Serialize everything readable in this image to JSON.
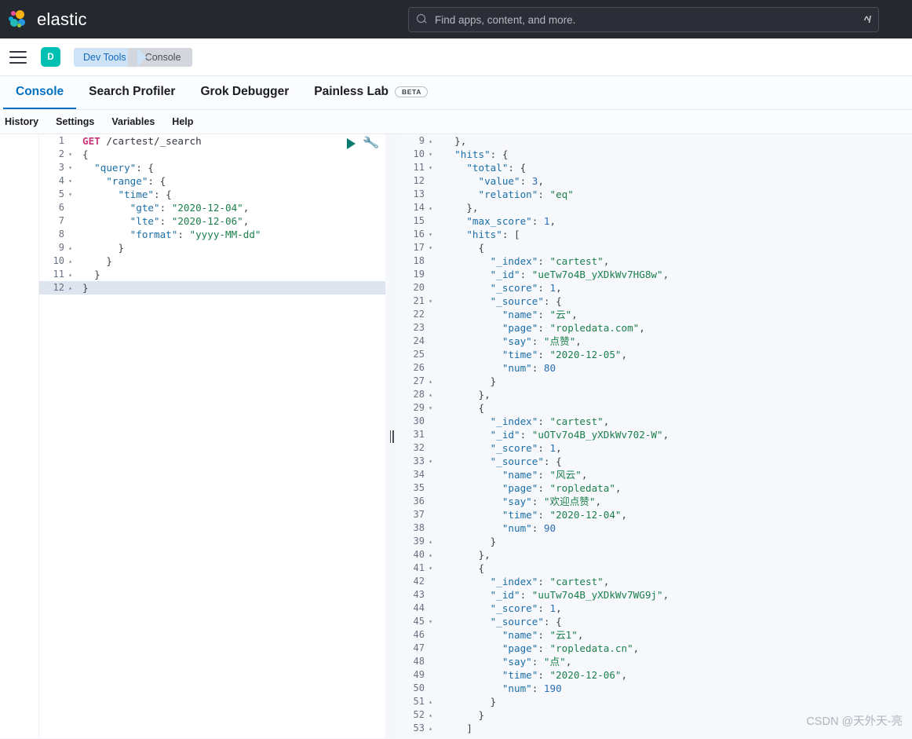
{
  "header": {
    "brand": "elastic",
    "search": {
      "placeholder": "Find apps, content, and more.",
      "value": "",
      "shortcut": "^/"
    }
  },
  "nav": {
    "avatar_initial": "D",
    "breadcrumb": [
      "Dev Tools",
      "Console"
    ]
  },
  "tabs": [
    {
      "label": "Console",
      "active": true,
      "badge": ""
    },
    {
      "label": "Search Profiler",
      "active": false,
      "badge": ""
    },
    {
      "label": "Grok Debugger",
      "active": false,
      "badge": ""
    },
    {
      "label": "Painless Lab",
      "active": false,
      "badge": "BETA"
    }
  ],
  "subbar": [
    "History",
    "Settings",
    "Variables",
    "Help"
  ],
  "editor": {
    "active_line": 12,
    "lines": [
      {
        "n": 1,
        "fold": "",
        "html": "<span class='t-method'>GET</span> <span class='t-url'>/cartest/_search</span>"
      },
      {
        "n": 2,
        "fold": "▾",
        "html": "<span class='t-brace'>{</span>"
      },
      {
        "n": 3,
        "fold": "▾",
        "html": "  <span class='t-key'>\"query\"</span><span class='t-punc'>: {</span>"
      },
      {
        "n": 4,
        "fold": "▾",
        "html": "    <span class='t-key'>\"range\"</span><span class='t-punc'>: {</span>"
      },
      {
        "n": 5,
        "fold": "▾",
        "html": "      <span class='t-key'>\"time\"</span><span class='t-punc'>: {</span>"
      },
      {
        "n": 6,
        "fold": "",
        "html": "        <span class='t-key'>\"gte\"</span><span class='t-punc'>: </span><span class='t-str'>\"2020-12-04\"</span><span class='t-punc'>,</span>"
      },
      {
        "n": 7,
        "fold": "",
        "html": "        <span class='t-key'>\"lte\"</span><span class='t-punc'>: </span><span class='t-str'>\"2020-12-06\"</span><span class='t-punc'>,</span>"
      },
      {
        "n": 8,
        "fold": "",
        "html": "        <span class='t-key'>\"format\"</span><span class='t-punc'>: </span><span class='t-str'>\"yyyy-MM-dd\"</span>"
      },
      {
        "n": 9,
        "fold": "▴",
        "html": "      <span class='t-punc'>}</span>"
      },
      {
        "n": 10,
        "fold": "▴",
        "html": "    <span class='t-punc'>}</span>"
      },
      {
        "n": 11,
        "fold": "▴",
        "html": "  <span class='t-punc'>}</span>"
      },
      {
        "n": 12,
        "fold": "▴",
        "html": "<span class='t-punc'>}</span>"
      }
    ]
  },
  "response": {
    "lines": [
      {
        "n": 9,
        "fold": "▴",
        "html": "  <span class='t-punc'>},</span>"
      },
      {
        "n": 10,
        "fold": "▾",
        "html": "  <span class='t-key'>\"hits\"</span><span class='t-punc'>: {</span>"
      },
      {
        "n": 11,
        "fold": "▾",
        "html": "    <span class='t-key'>\"total\"</span><span class='t-punc'>: {</span>"
      },
      {
        "n": 12,
        "fold": "",
        "html": "      <span class='t-key'>\"value\"</span><span class='t-punc'>: </span><span class='t-num'>3</span><span class='t-punc'>,</span>"
      },
      {
        "n": 13,
        "fold": "",
        "html": "      <span class='t-key'>\"relation\"</span><span class='t-punc'>: </span><span class='t-str'>\"eq\"</span>"
      },
      {
        "n": 14,
        "fold": "▴",
        "html": "    <span class='t-punc'>},</span>"
      },
      {
        "n": 15,
        "fold": "",
        "html": "    <span class='t-key'>\"max_score\"</span><span class='t-punc'>: </span><span class='t-num'>1</span><span class='t-punc'>,</span>"
      },
      {
        "n": 16,
        "fold": "▾",
        "html": "    <span class='t-key'>\"hits\"</span><span class='t-punc'>: [</span>"
      },
      {
        "n": 17,
        "fold": "▾",
        "html": "      <span class='t-punc'>{</span>"
      },
      {
        "n": 18,
        "fold": "",
        "html": "        <span class='t-key'>\"_index\"</span><span class='t-punc'>: </span><span class='t-str'>\"cartest\"</span><span class='t-punc'>,</span>"
      },
      {
        "n": 19,
        "fold": "",
        "html": "        <span class='t-key'>\"_id\"</span><span class='t-punc'>: </span><span class='t-str'>\"ueTw7o4B_yXDkWv7HG8w\"</span><span class='t-punc'>,</span>"
      },
      {
        "n": 20,
        "fold": "",
        "html": "        <span class='t-key'>\"_score\"</span><span class='t-punc'>: </span><span class='t-num'>1</span><span class='t-punc'>,</span>"
      },
      {
        "n": 21,
        "fold": "▾",
        "html": "        <span class='t-key'>\"_source\"</span><span class='t-punc'>: {</span>"
      },
      {
        "n": 22,
        "fold": "",
        "html": "          <span class='t-key'>\"name\"</span><span class='t-punc'>: </span><span class='t-str'>\"云\"</span><span class='t-punc'>,</span>"
      },
      {
        "n": 23,
        "fold": "",
        "html": "          <span class='t-key'>\"page\"</span><span class='t-punc'>: </span><span class='t-str'>\"ropledata.com\"</span><span class='t-punc'>,</span>"
      },
      {
        "n": 24,
        "fold": "",
        "html": "          <span class='t-key'>\"say\"</span><span class='t-punc'>: </span><span class='t-str'>\"点赞\"</span><span class='t-punc'>,</span>"
      },
      {
        "n": 25,
        "fold": "",
        "html": "          <span class='t-key'>\"time\"</span><span class='t-punc'>: </span><span class='t-str'>\"2020-12-05\"</span><span class='t-punc'>,</span>"
      },
      {
        "n": 26,
        "fold": "",
        "html": "          <span class='t-key'>\"num\"</span><span class='t-punc'>: </span><span class='t-num'>80</span>"
      },
      {
        "n": 27,
        "fold": "▴",
        "html": "        <span class='t-punc'>}</span>"
      },
      {
        "n": 28,
        "fold": "▴",
        "html": "      <span class='t-punc'>},</span>"
      },
      {
        "n": 29,
        "fold": "▾",
        "html": "      <span class='t-punc'>{</span>"
      },
      {
        "n": 30,
        "fold": "",
        "html": "        <span class='t-key'>\"_index\"</span><span class='t-punc'>: </span><span class='t-str'>\"cartest\"</span><span class='t-punc'>,</span>"
      },
      {
        "n": 31,
        "fold": "",
        "html": "        <span class='t-key'>\"_id\"</span><span class='t-punc'>: </span><span class='t-str'>\"uOTv7o4B_yXDkWv702-W\"</span><span class='t-punc'>,</span>"
      },
      {
        "n": 32,
        "fold": "",
        "html": "        <span class='t-key'>\"_score\"</span><span class='t-punc'>: </span><span class='t-num'>1</span><span class='t-punc'>,</span>"
      },
      {
        "n": 33,
        "fold": "▾",
        "html": "        <span class='t-key'>\"_source\"</span><span class='t-punc'>: {</span>"
      },
      {
        "n": 34,
        "fold": "",
        "html": "          <span class='t-key'>\"name\"</span><span class='t-punc'>: </span><span class='t-str'>\"风云\"</span><span class='t-punc'>,</span>"
      },
      {
        "n": 35,
        "fold": "",
        "html": "          <span class='t-key'>\"page\"</span><span class='t-punc'>: </span><span class='t-str'>\"ropledata\"</span><span class='t-punc'>,</span>"
      },
      {
        "n": 36,
        "fold": "",
        "html": "          <span class='t-key'>\"say\"</span><span class='t-punc'>: </span><span class='t-str'>\"欢迎点赞\"</span><span class='t-punc'>,</span>"
      },
      {
        "n": 37,
        "fold": "",
        "html": "          <span class='t-key'>\"time\"</span><span class='t-punc'>: </span><span class='t-str'>\"2020-12-04\"</span><span class='t-punc'>,</span>"
      },
      {
        "n": 38,
        "fold": "",
        "html": "          <span class='t-key'>\"num\"</span><span class='t-punc'>: </span><span class='t-num'>90</span>"
      },
      {
        "n": 39,
        "fold": "▴",
        "html": "        <span class='t-punc'>}</span>"
      },
      {
        "n": 40,
        "fold": "▴",
        "html": "      <span class='t-punc'>},</span>"
      },
      {
        "n": 41,
        "fold": "▾",
        "html": "      <span class='t-punc'>{</span>"
      },
      {
        "n": 42,
        "fold": "",
        "html": "        <span class='t-key'>\"_index\"</span><span class='t-punc'>: </span><span class='t-str'>\"cartest\"</span><span class='t-punc'>,</span>"
      },
      {
        "n": 43,
        "fold": "",
        "html": "        <span class='t-key'>\"_id\"</span><span class='t-punc'>: </span><span class='t-str'>\"uuTw7o4B_yXDkWv7WG9j\"</span><span class='t-punc'>,</span>"
      },
      {
        "n": 44,
        "fold": "",
        "html": "        <span class='t-key'>\"_score\"</span><span class='t-punc'>: </span><span class='t-num'>1</span><span class='t-punc'>,</span>"
      },
      {
        "n": 45,
        "fold": "▾",
        "html": "        <span class='t-key'>\"_source\"</span><span class='t-punc'>: {</span>"
      },
      {
        "n": 46,
        "fold": "",
        "html": "          <span class='t-key'>\"name\"</span><span class='t-punc'>: </span><span class='t-str'>\"云1\"</span><span class='t-punc'>,</span>"
      },
      {
        "n": 47,
        "fold": "",
        "html": "          <span class='t-key'>\"page\"</span><span class='t-punc'>: </span><span class='t-str'>\"ropledata.cn\"</span><span class='t-punc'>,</span>"
      },
      {
        "n": 48,
        "fold": "",
        "html": "          <span class='t-key'>\"say\"</span><span class='t-punc'>: </span><span class='t-str'>\"点\"</span><span class='t-punc'>,</span>"
      },
      {
        "n": 49,
        "fold": "",
        "html": "          <span class='t-key'>\"time\"</span><span class='t-punc'>: </span><span class='t-str'>\"2020-12-06\"</span><span class='t-punc'>,</span>"
      },
      {
        "n": 50,
        "fold": "",
        "html": "          <span class='t-key'>\"num\"</span><span class='t-punc'>: </span><span class='t-num'>190</span>"
      },
      {
        "n": 51,
        "fold": "▴",
        "html": "        <span class='t-punc'>}</span>"
      },
      {
        "n": 52,
        "fold": "▴",
        "html": "      <span class='t-punc'>}</span>"
      },
      {
        "n": 53,
        "fold": "▴",
        "html": "    <span class='t-punc'>]</span>"
      }
    ]
  },
  "icons": {
    "play": "play-icon",
    "wrench": "wrench-icon"
  },
  "watermark": "CSDN @天外天-亮",
  "colors": {
    "accent": "#0071c2",
    "brand_teal": "#00bfb3",
    "header_bg": "#25282f",
    "string_green": "#1a7f4b",
    "key_blue": "#1a6ea8",
    "method_pink": "#c9357c"
  }
}
